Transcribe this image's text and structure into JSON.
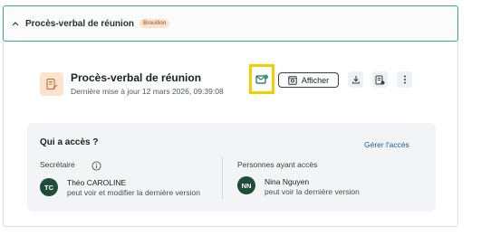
{
  "panel": {
    "title": "Procès-verbal de réunion",
    "badge": "Brouillon"
  },
  "document": {
    "title": "Procès-verbal de réunion",
    "updated": "Dernière mise à jour 12 mars 2026, 09:39:08"
  },
  "toolbar": {
    "view_label": "Afficher"
  },
  "access": {
    "title": "Qui a accès ?",
    "manage_link": "Gérer l'accès",
    "secretary_label": "Secrétaire",
    "people_label": "Personnes ayant accès",
    "secretary": {
      "initials": "TC",
      "name": "Théo CAROLINE",
      "role": "peut voir et modifier la dernière version"
    },
    "person": {
      "initials": "NN",
      "name": "Nina Nguyen",
      "role": "peut voir la dernière version"
    }
  },
  "colors": {
    "accent": "#3aa889",
    "highlight": "#f2d000",
    "avatar": "#1f4d3a",
    "link": "#1f5fa0"
  }
}
